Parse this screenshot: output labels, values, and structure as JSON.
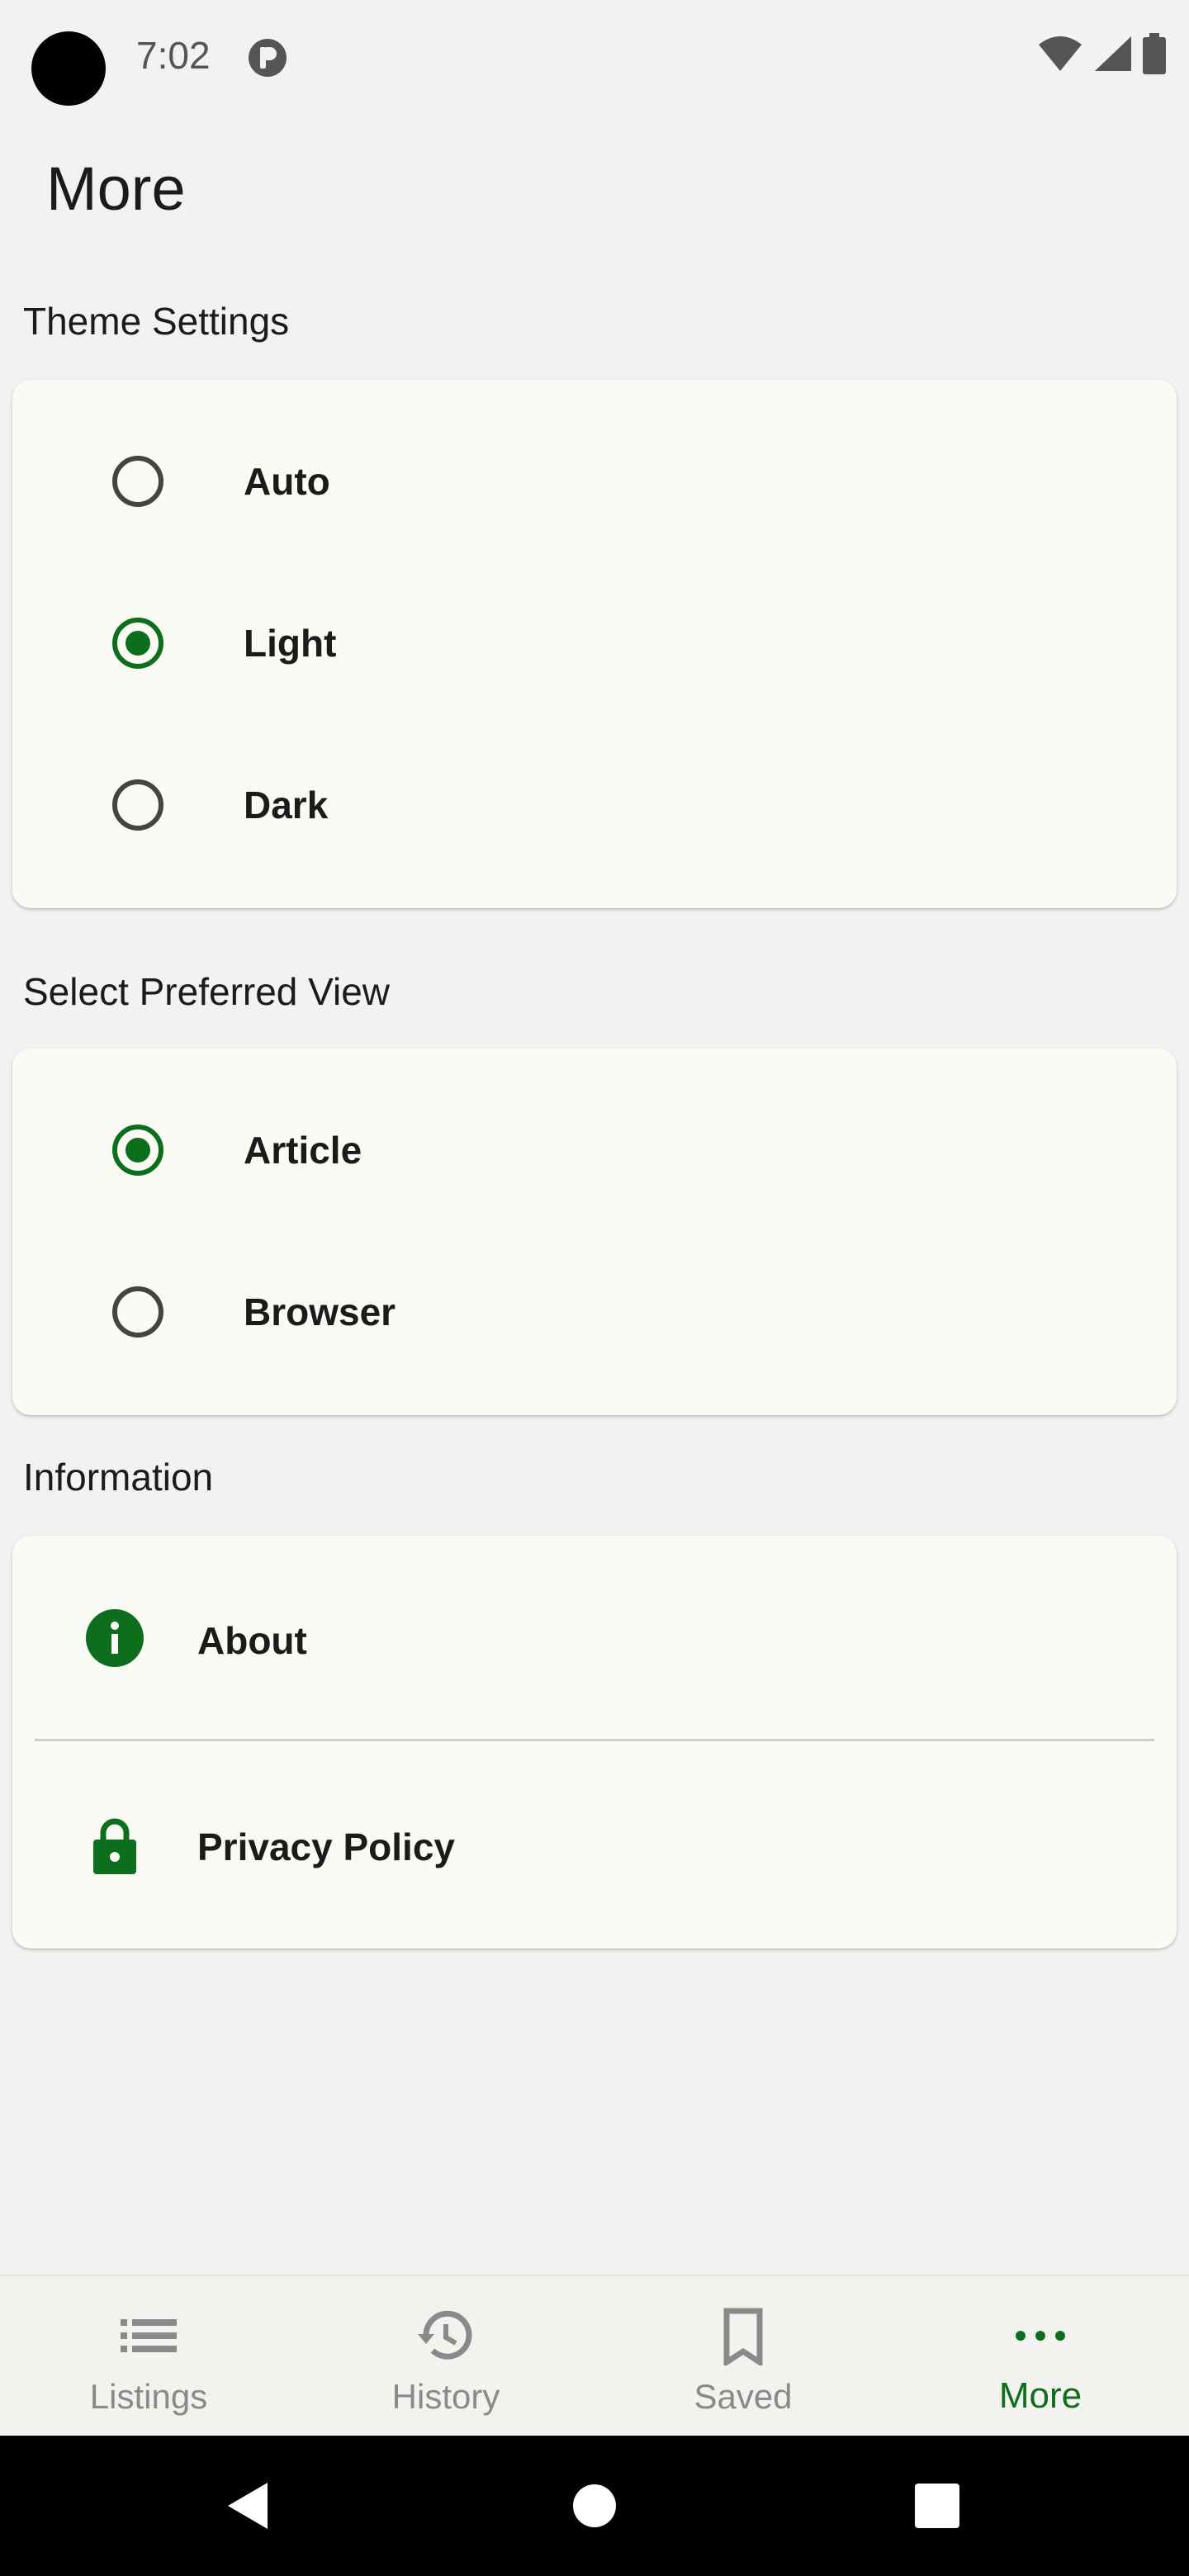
{
  "status_bar": {
    "time": "7:02"
  },
  "page": {
    "title": "More"
  },
  "theme": {
    "heading": "Theme Settings",
    "options": [
      {
        "label": "Auto",
        "checked": false
      },
      {
        "label": "Light",
        "checked": true
      },
      {
        "label": "Dark",
        "checked": false
      }
    ]
  },
  "view": {
    "heading": "Select Preferred View",
    "options": [
      {
        "label": "Article",
        "checked": true
      },
      {
        "label": "Browser",
        "checked": false
      }
    ]
  },
  "information": {
    "heading": "Information",
    "items": [
      {
        "label": "About",
        "icon": "info-icon"
      },
      {
        "label": "Privacy Policy",
        "icon": "lock-icon"
      }
    ]
  },
  "bottom_nav": {
    "items": [
      {
        "label": "Listings",
        "icon": "list-icon",
        "active": false
      },
      {
        "label": "History",
        "icon": "history-icon",
        "active": false
      },
      {
        "label": "Saved",
        "icon": "bookmark-icon",
        "active": false
      },
      {
        "label": "More",
        "icon": "more-icon",
        "active": true
      }
    ]
  },
  "colors": {
    "accent": "#0d6f1d",
    "card": "#fbfbf6",
    "background": "#f2f2f2"
  }
}
